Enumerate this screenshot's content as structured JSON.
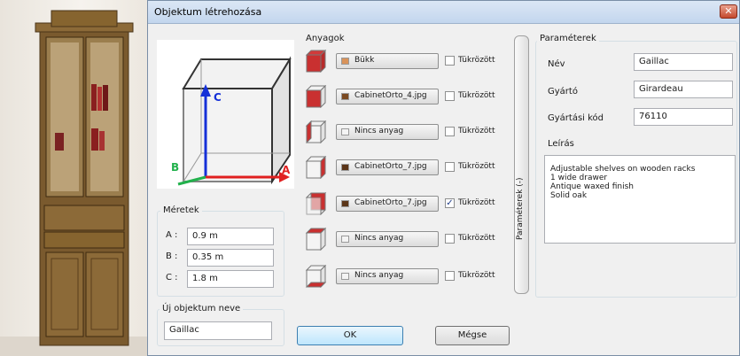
{
  "window": {
    "title": "Objektum létrehozása",
    "close_glyph": "✕"
  },
  "dimensions": {
    "legend": "Méretek",
    "rows": [
      {
        "label": "A :",
        "value": "0.9 m"
      },
      {
        "label": "B :",
        "value": "0.35 m"
      },
      {
        "label": "C :",
        "value": "1.8 m"
      }
    ]
  },
  "cube": {
    "axis_a": "A",
    "axis_b": "B",
    "axis_c": "C",
    "color_a": "#e02020",
    "color_b": "#22b14c",
    "color_c": "#1530d8"
  },
  "new_object": {
    "legend": "Új objektum neve",
    "value": "Gaillac"
  },
  "materials": {
    "legend": "Anyagok",
    "mirror_label": "Tükrözött",
    "items": [
      {
        "name": "Bükk",
        "swatch": "#d9935a",
        "mirrored": false,
        "check": "",
        "face": "all"
      },
      {
        "name": "CabinetOrto_4.jpg",
        "swatch": "#7a4a22",
        "mirrored": false,
        "check": "",
        "face": "front"
      },
      {
        "name": "Nincs anyag",
        "swatch": "#f4f4f4",
        "mirrored": false,
        "check": "",
        "face": "left"
      },
      {
        "name": "CabinetOrto_7.jpg",
        "swatch": "#5b3518",
        "mirrored": false,
        "check": "",
        "face": "right"
      },
      {
        "name": "CabinetOrto_7.jpg",
        "swatch": "#5b3518",
        "mirrored": true,
        "check": "✓",
        "face": "back"
      },
      {
        "name": "Nincs anyag",
        "swatch": "#f4f4f4",
        "mirrored": false,
        "check": "",
        "face": "top"
      },
      {
        "name": "Nincs anyag",
        "swatch": "#f4f4f4",
        "mirrored": false,
        "check": "",
        "face": "bottom"
      }
    ]
  },
  "params_tab": {
    "label": "Paraméterek  (-)"
  },
  "parameters": {
    "legend": "Paraméterek",
    "name_label": "Név",
    "name_value": "Gaillac",
    "maker_label": "Gyártó",
    "maker_value": "Girardeau",
    "code_label": "Gyártási kód",
    "code_value": "76110",
    "desc_label": "Leírás",
    "description": [
      "Adjustable shelves on wooden racks",
      "1 wide drawer",
      "Antique waxed finish",
      "Solid oak"
    ]
  },
  "buttons": {
    "ok": "OK",
    "cancel": "Mégse"
  }
}
